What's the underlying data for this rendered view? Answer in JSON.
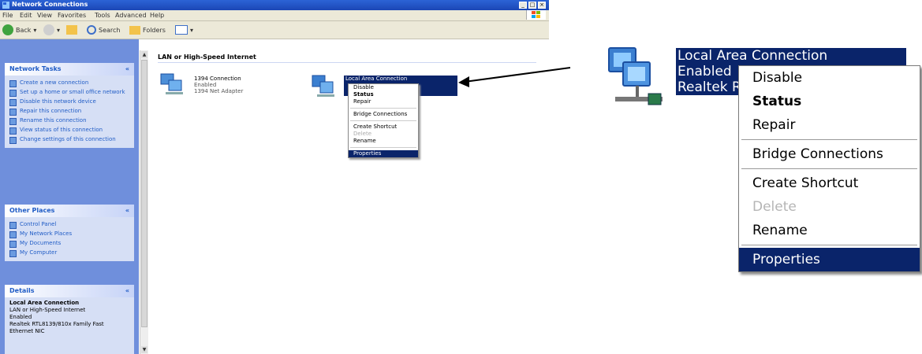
{
  "window": {
    "title": "Network Connections",
    "controls": [
      "_",
      "□",
      "×"
    ]
  },
  "menubar": [
    "File",
    "Edit",
    "View",
    "Favorites",
    "Tools",
    "Advanced",
    "Help"
  ],
  "toolbar": {
    "back": "Back",
    "search": "Search",
    "folders": "Folders"
  },
  "task_panes": {
    "network_tasks": {
      "title": "Network Tasks",
      "items": [
        "Create a new connection",
        "Set up a home or small office network",
        "Disable this network device",
        "Repair this connection",
        "Rename this connection",
        "View status of this connection",
        "Change settings of this connection"
      ]
    },
    "other_places": {
      "title": "Other Places",
      "items": [
        "Control Panel",
        "My Network Places",
        "My Documents",
        "My Computer"
      ]
    },
    "details": {
      "title": "Details",
      "name": "Local Area Connection",
      "lines": [
        "LAN or High-Speed Internet",
        "Enabled",
        "Realtek RTL8139/810x Family Fast Ethernet NIC"
      ]
    }
  },
  "content": {
    "group_header": "LAN or High-Speed Internet",
    "connection1": {
      "name": "1394 Connection",
      "status": "Enabled",
      "device": "1394 Net Adapter"
    },
    "connection2": {
      "name": "Local Area Connection"
    }
  },
  "context_menu": {
    "items": [
      {
        "label": "Disable"
      },
      {
        "label": "Status",
        "bold": true
      },
      {
        "label": "Repair"
      },
      {
        "separator": true
      },
      {
        "label": "Bridge Connections"
      },
      {
        "separator": true
      },
      {
        "label": "Create Shortcut"
      },
      {
        "label": "Delete",
        "disabled": true
      },
      {
        "label": "Rename"
      },
      {
        "separator": true
      },
      {
        "label": "Properties",
        "selected": true
      }
    ]
  },
  "zoom": {
    "label_lines": [
      "Local Area Connection",
      "Enabled",
      "Realtek R"
    ]
  }
}
